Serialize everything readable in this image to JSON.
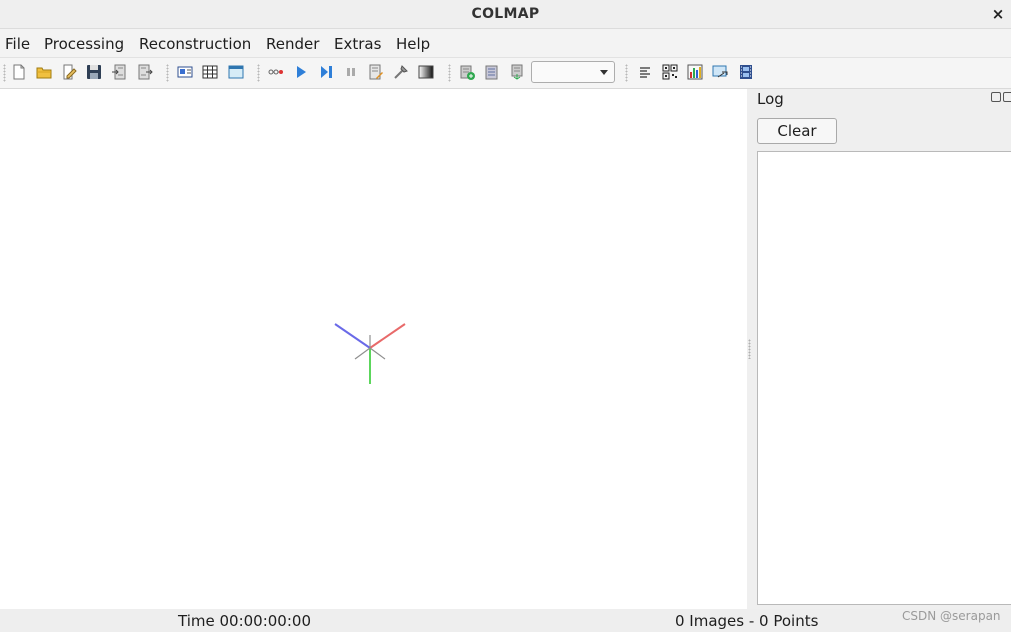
{
  "window": {
    "title": "COLMAP",
    "close_glyph": "×"
  },
  "menu": [
    "File",
    "Processing",
    "Reconstruction",
    "Render",
    "Extras",
    "Help"
  ],
  "toolbar": {
    "groups": [
      [
        "new-project-icon",
        "open-project-icon",
        "edit-project-icon",
        "save-project-icon",
        "import-model-icon",
        "export-model-icon"
      ],
      [
        "feature-extraction-icon",
        "feature-matching-icon",
        "database-management-icon"
      ],
      [
        "automatic-reconstruction-icon",
        "start-reconstruction-icon",
        "step-reconstruction-icon",
        "pause-reconstruction-icon",
        "reconstruction-options-icon",
        "bundle-adjustment-icon",
        "dense-reconstruction-icon"
      ],
      [
        "add-reconstruction-icon",
        "reset-reconstruction-icon",
        "export-reconstruction-icon"
      ],
      [
        "reconstruction-stats-icon",
        "match-matrix-icon",
        "statistics-chart-icon",
        "render-options-icon",
        "grab-movie-icon"
      ]
    ],
    "reconstruction_select_value": ""
  },
  "log_panel": {
    "title": "Log",
    "clear_label": "Clear"
  },
  "status": {
    "time": "Time 00:00:00:00",
    "counts": "0 Images - 0 Points"
  },
  "watermark": "CSDN @serapan",
  "colors": {
    "axis_x": "#e86a6a",
    "axis_y": "#5cd65c",
    "axis_z": "#6a6ae8",
    "grid_gray": "#8f8f8f"
  }
}
